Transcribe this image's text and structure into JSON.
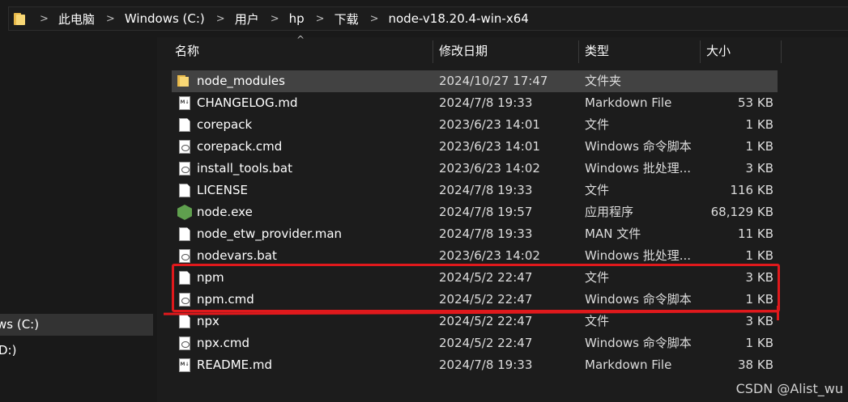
{
  "breadcrumb": {
    "items": [
      "此电脑",
      "Windows (C:)",
      "用户",
      "hp",
      "下载",
      "node-v18.20.4-win-x64"
    ],
    "separator": ">"
  },
  "sidebar": {
    "items": [
      {
        "label": "ws (C:)",
        "selected": true
      },
      {
        "label": "D:)",
        "selected": false
      }
    ]
  },
  "columns": {
    "name": "名称",
    "date": "修改日期",
    "type": "类型",
    "size": "大小"
  },
  "files": [
    {
      "name": "node_modules",
      "date": "2024/10/27 17:47",
      "type": "文件夹",
      "size": "",
      "icon": "folder-icon"
    },
    {
      "name": "CHANGELOG.md",
      "date": "2024/7/8 19:33",
      "type": "Markdown File",
      "size": "53 KB",
      "icon": "markdown-file-icon"
    },
    {
      "name": "corepack",
      "date": "2023/6/23 14:01",
      "type": "文件",
      "size": "1 KB",
      "icon": "file-icon"
    },
    {
      "name": "corepack.cmd",
      "date": "2023/6/23 14:01",
      "type": "Windows 命令脚本",
      "size": "1 KB",
      "icon": "script-file-icon"
    },
    {
      "name": "install_tools.bat",
      "date": "2023/6/23 14:02",
      "type": "Windows 批处理...",
      "size": "3 KB",
      "icon": "script-file-icon"
    },
    {
      "name": "LICENSE",
      "date": "2024/7/8 19:33",
      "type": "文件",
      "size": "116 KB",
      "icon": "file-icon"
    },
    {
      "name": "node.exe",
      "date": "2024/7/8 19:57",
      "type": "应用程序",
      "size": "68,129 KB",
      "icon": "nodejs-icon"
    },
    {
      "name": "node_etw_provider.man",
      "date": "2024/7/8 19:33",
      "type": "MAN 文件",
      "size": "11 KB",
      "icon": "file-icon"
    },
    {
      "name": "nodevars.bat",
      "date": "2023/6/23 14:02",
      "type": "Windows 批处理...",
      "size": "1 KB",
      "icon": "script-file-icon"
    },
    {
      "name": "npm",
      "date": "2024/5/2 22:47",
      "type": "文件",
      "size": "3 KB",
      "icon": "file-icon"
    },
    {
      "name": "npm.cmd",
      "date": "2024/5/2 22:47",
      "type": "Windows 命令脚本",
      "size": "1 KB",
      "icon": "script-file-icon"
    },
    {
      "name": "npx",
      "date": "2024/5/2 22:47",
      "type": "文件",
      "size": "3 KB",
      "icon": "file-icon"
    },
    {
      "name": "npx.cmd",
      "date": "2024/5/2 22:47",
      "type": "Windows 命令脚本",
      "size": "1 KB",
      "icon": "script-file-icon"
    },
    {
      "name": "README.md",
      "date": "2024/7/8 19:33",
      "type": "Markdown File",
      "size": "38 KB",
      "icon": "markdown-file-icon"
    }
  ],
  "highlighted_row": 0,
  "annotation_color": "#e0191c",
  "watermark": "CSDN @Alist_wu"
}
